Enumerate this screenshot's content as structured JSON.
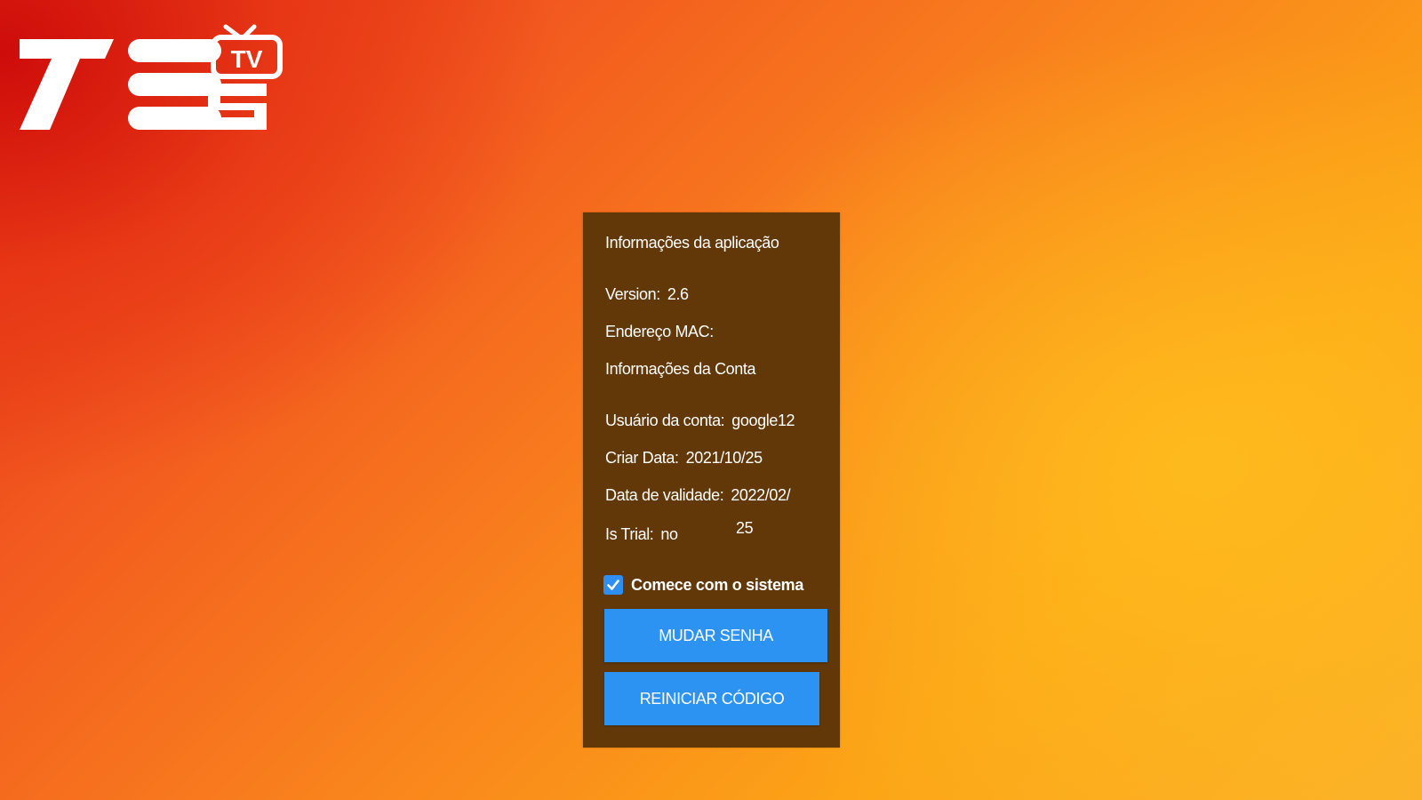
{
  "logo": {
    "text": "7ES",
    "badge": "TV",
    "color": "#ffffff"
  },
  "panel": {
    "background": "#623809",
    "app_info_title": "Informações da aplicação",
    "version_label": "Version:",
    "version_value": "2.6",
    "mac_label": "Endereço MAC:",
    "account_info_title": "Informações da Conta",
    "user_label": "Usuário da conta:",
    "user_value": "google12",
    "created_label": "Criar Data:",
    "created_value": "2021/10/25",
    "expiry_label": "Data de validade:",
    "expiry_value_line1": "2022/02/",
    "expiry_value_line2": "25",
    "trial_label": "Is Trial:",
    "trial_value": "no",
    "start_with_system": {
      "label": "Comece com o sistema",
      "checked": true,
      "color": "#2f8ff0"
    },
    "change_password_button": "MUDAR SENHA",
    "reset_code_button": "REINICIAR CÓDIGO",
    "button_color": "#2d93f3"
  }
}
